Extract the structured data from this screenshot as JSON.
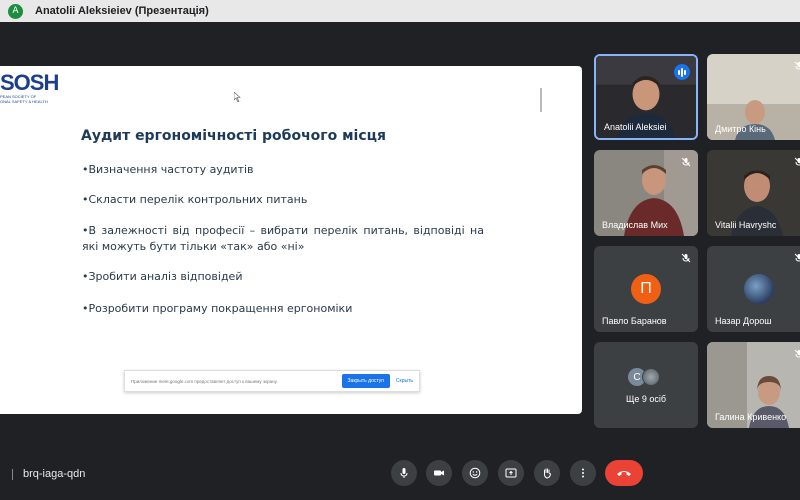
{
  "window": {
    "avatar_letter": "A",
    "title": "Anatolii Aleksieiev (Презентація)"
  },
  "slide": {
    "logo_big": "SOSH",
    "logo_small_1": "PEAN SOCIETY OF",
    "logo_small_2": "ONAL SAFETY & HEALTH",
    "title": "Аудит ергономічності робочого місця",
    "bullets": [
      "•Визначення частоту аудитів",
      "•Скласти перелік контрольних питань",
      "•В залежності від професії – вибрати перелік питань, відповіді на які можуть бути тільки «так» або «ні»",
      "•Зробити аналіз відповідей",
      "•Розробити програму покращення ергономіки"
    ],
    "notice": {
      "text": "Приложение meet.google.com предоставляет доступ к вашему экрану.",
      "button": "Закрыть доступ",
      "link": "Скрыть"
    }
  },
  "participants": [
    {
      "name": "Anatolii Aleksiei",
      "speaking": true
    },
    {
      "name": "Дмитро Кінь",
      "muted": true
    },
    {
      "name": "Владислав Мих",
      "muted": true
    },
    {
      "name": "Vitalii Havryshc",
      "muted": true
    },
    {
      "name": "Павло Баранов",
      "initial": "П",
      "muted": true
    },
    {
      "name": "Назар Дорош",
      "muted": true
    },
    {
      "name": "Ще 9 осіб",
      "initial": "С"
    },
    {
      "name": "Галина Кривенко",
      "muted": true
    }
  ],
  "bottom": {
    "meeting_code": "brq-iaga-qdn"
  },
  "colors": {
    "accent": "#1a73e8",
    "end_call": "#ea4335",
    "avatar_orange": "#f06014",
    "background": "#202124",
    "tile": "#3c4043"
  },
  "icons": [
    "mic-icon",
    "camera-icon",
    "emoji-icon",
    "present-icon",
    "raise-hand-icon",
    "more-options-icon",
    "end-call-icon",
    "mic-off-icon",
    "speaking-icon"
  ]
}
